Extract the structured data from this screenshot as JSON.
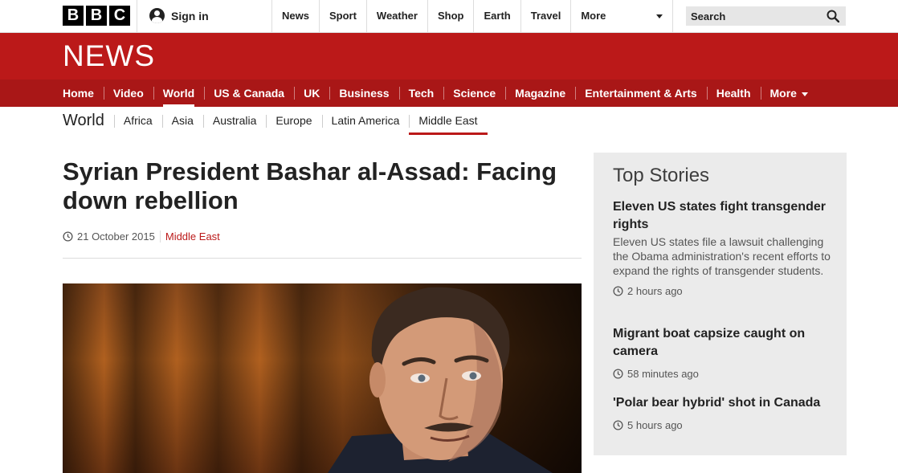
{
  "brand": {
    "letters": [
      "B",
      "B",
      "C"
    ]
  },
  "account": {
    "sign_in": "Sign in"
  },
  "top_nav": [
    "News",
    "Sport",
    "Weather",
    "Shop",
    "Earth",
    "Travel"
  ],
  "top_nav_more": "More",
  "search": {
    "placeholder": "Search"
  },
  "news_banner": "NEWS",
  "section_nav": {
    "items": [
      "Home",
      "Video",
      "World",
      "US & Canada",
      "UK",
      "Business",
      "Tech",
      "Science",
      "Magazine",
      "Entertainment & Arts",
      "Health"
    ],
    "more": "More",
    "active": "World"
  },
  "sub_nav": {
    "title": "World",
    "items": [
      "Africa",
      "Asia",
      "Australia",
      "Europe",
      "Latin America",
      "Middle East"
    ],
    "active": "Middle East"
  },
  "article": {
    "headline": "Syrian President Bashar al-Assad: Facing down rebellion",
    "date": "21 October 2015",
    "section": "Middle East"
  },
  "top_stories": {
    "title": "Top Stories",
    "items": [
      {
        "headline": "Eleven US states fight transgender rights",
        "summary": "Eleven US states file a lawsuit challenging the Obama administration's recent efforts to expand the rights of transgender students.",
        "time": "2 hours ago"
      },
      {
        "headline": "Migrant boat capsize caught on camera",
        "summary": "",
        "time": "58 minutes ago"
      },
      {
        "headline": "'Polar bear hybrid' shot in Canada",
        "summary": "",
        "time": "5 hours ago"
      }
    ]
  },
  "colors": {
    "bbc_red": "#bb1919",
    "nav_red": "#a91717",
    "panel_gray": "#ebebeb"
  }
}
